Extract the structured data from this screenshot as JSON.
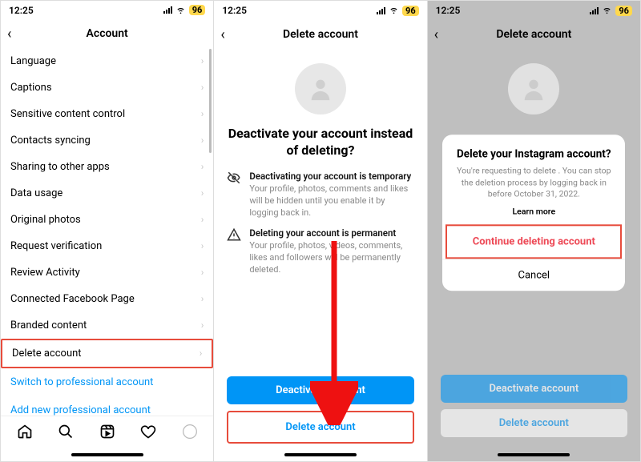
{
  "status": {
    "time": "12:25",
    "battery": "96"
  },
  "screen1": {
    "title": "Account",
    "rows": [
      "Language",
      "Captions",
      "Sensitive content control",
      "Contacts syncing",
      "Sharing to other apps",
      "Data usage",
      "Original photos",
      "Request verification",
      "Review Activity",
      "Connected Facebook Page",
      "Branded content",
      "Delete account"
    ],
    "link1": "Switch to professional account",
    "link2": "Add new professional account"
  },
  "screen2": {
    "title": "Delete account",
    "heading": "Deactivate your account instead of deleting?",
    "info1_b": "Deactivating your account is temporary",
    "info1_t": "Your profile, photos, comments and likes will be hidden until you enable it by logging back in.",
    "info2_b": "Deleting your account is permanent",
    "info2_t": "Your profile, photos, videos, comments, likes and followers will be permanently deleted.",
    "btn_deact": "Deactivate account",
    "btn_del": "Delete account"
  },
  "screen3": {
    "title": "Delete account",
    "btn_deact": "Deactivate account",
    "btn_del": "Delete account",
    "modal_title": "Delete your Instagram account?",
    "modal_body": "You're requesting to delete . You can stop the deletion process by logging back in before October 31, 2022.",
    "modal_learn": "Learn more",
    "modal_cont": "Continue deleting account",
    "modal_cancel": "Cancel"
  }
}
